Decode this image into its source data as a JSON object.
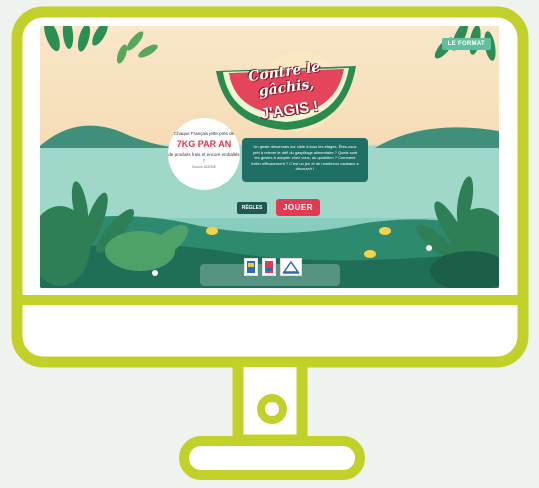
{
  "screen": {
    "corner_button": "LE FORMAT",
    "title_line1": "Contre le gâchis,",
    "title_line2": "J'AGIS !",
    "bubble": {
      "intro": "Chaque Français jette près de",
      "amount": "7KG PAR AN",
      "outro": "de produits frais et encore emballés !",
      "note": "Source ADEME"
    },
    "info_text": "Un geste désormais sur cible à tous les étages. Êtes-vous prêt à relever le défi du gaspillage alimentaire ? Quels sont les gestes à adopter chez vous, au quotidien ? Comment éviter efficacement ? C'est un jeu et de nombreux cadeaux à découvrir !",
    "rules_button": "RÈGLES",
    "play_button": "JOUER",
    "partners": [
      "partner-logo-1",
      "partner-logo-2",
      "partner-logo-3"
    ]
  },
  "colors": {
    "frame": "#c2d12a",
    "play": "#e23a52",
    "info_bg": "#1f6f66"
  }
}
